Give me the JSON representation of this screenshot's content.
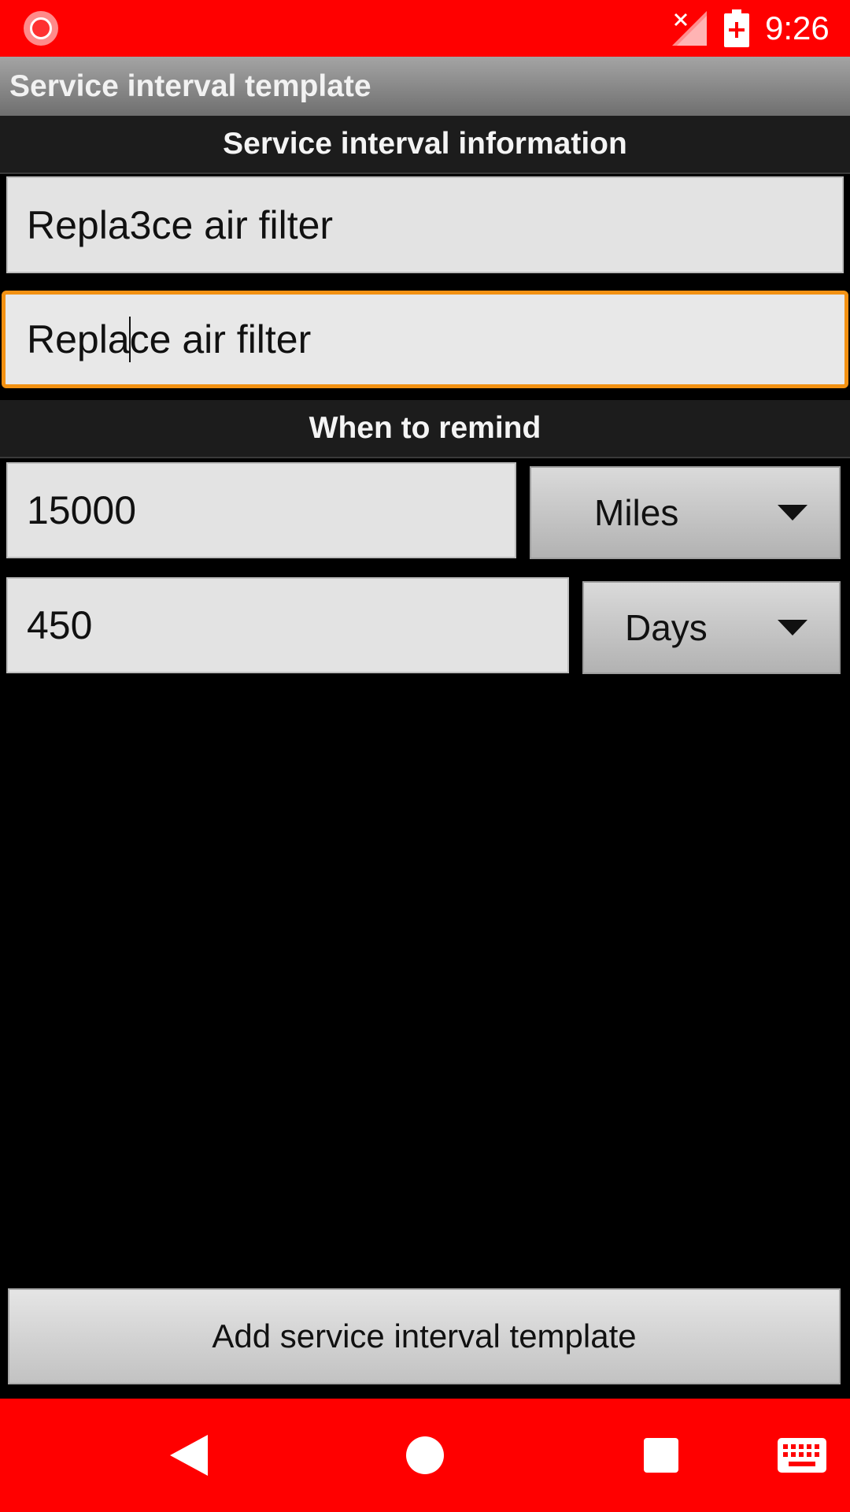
{
  "status_bar": {
    "time": "9:26",
    "icons": [
      "screen-record-icon",
      "no-signal-icon",
      "battery-charging-icon"
    ]
  },
  "title_bar": {
    "title": "Service interval template"
  },
  "sections": {
    "info_header": "Service interval information",
    "remind_header": "When to remind"
  },
  "fields": {
    "name_value": "Repla3ce air filter",
    "description_before_cursor": "Repla",
    "description_after_cursor": "ce air filter",
    "miles_value": "15000",
    "days_value": "450"
  },
  "spinners": {
    "distance_unit": "Miles",
    "time_unit": "Days"
  },
  "actions": {
    "add_label": "Add service interval template"
  },
  "nav_bar": {
    "icons": [
      "back-icon",
      "home-icon",
      "recents-icon",
      "keyboard-icon"
    ]
  },
  "colors": {
    "status_bar": "#ff0000",
    "nav_bar": "#ff0000",
    "focus_border": "#f29112",
    "section_header_bg": "#1c1c1c",
    "field_bg": "#e3e3e3"
  }
}
